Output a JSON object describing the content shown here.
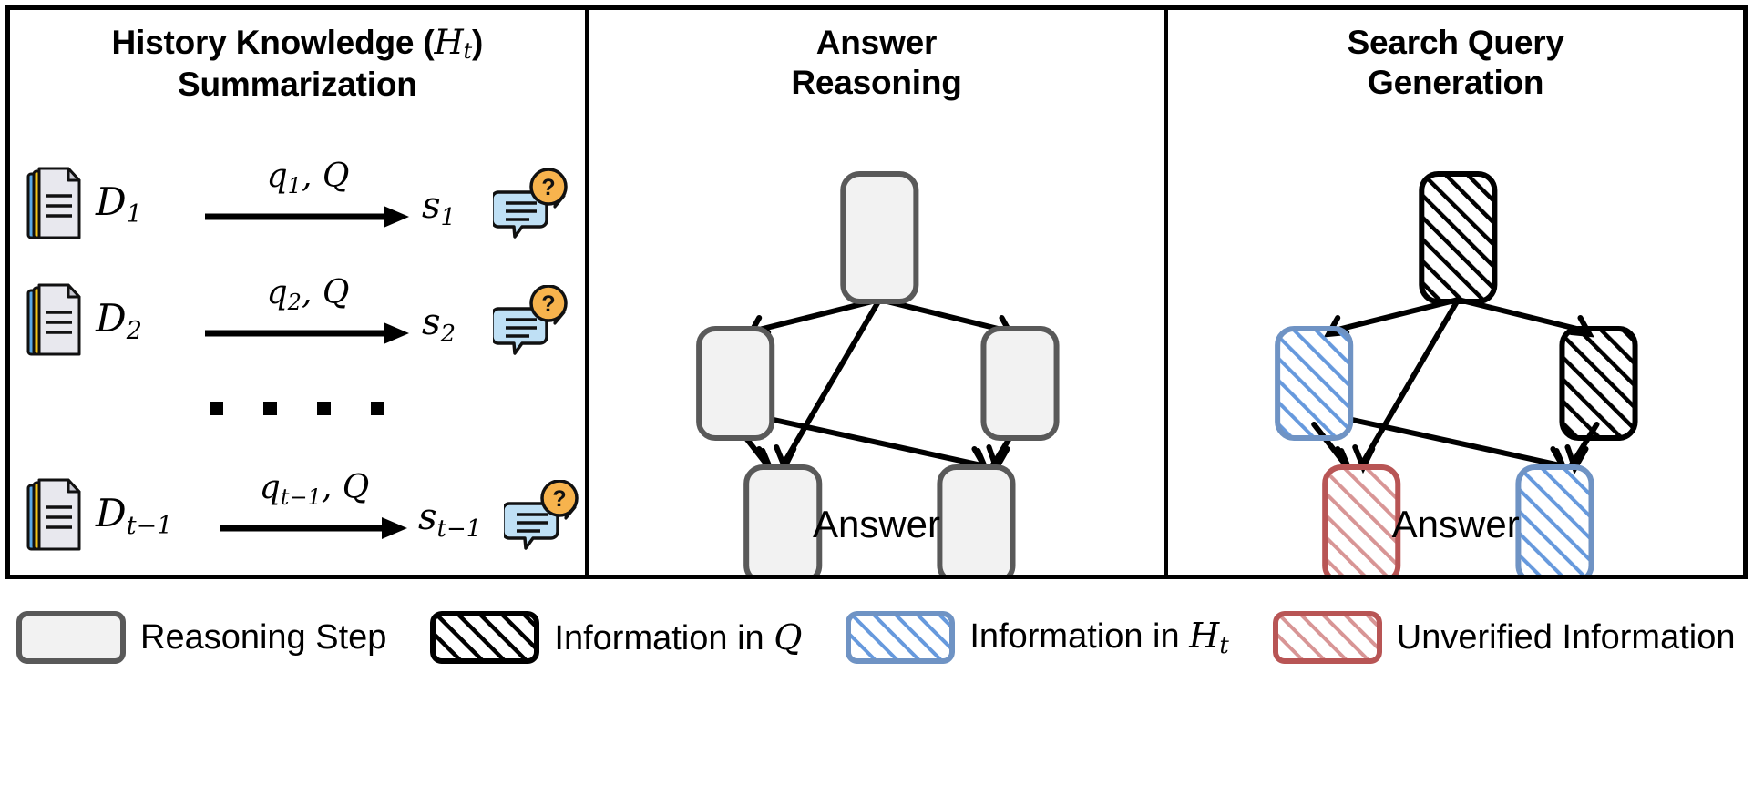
{
  "figure": {
    "panels": [
      {
        "id": "history-knowledge-summarization",
        "title_line1_pre": "History Knowledge (",
        "title_line1_cal": "H",
        "title_line1_sub": "t",
        "title_line1_post": ")",
        "title_line2": "Summarization",
        "rows": [
          {
            "doc": "D",
            "doc_sub": "1",
            "query": "q",
            "query_sub": "1",
            "query_rest": ", ",
            "query_cal": "Q",
            "summary": "s",
            "summary_sub": "1"
          },
          {
            "doc": "D",
            "doc_sub": "2",
            "query": "q",
            "query_sub": "2",
            "query_rest": ", ",
            "query_cal": "Q",
            "summary": "s",
            "summary_sub": "2"
          },
          {
            "doc": "D",
            "doc_sub": "t−1",
            "query": "q",
            "query_sub": "t−1",
            "query_rest": ", ",
            "query_cal": "Q",
            "summary": "s",
            "summary_sub": "t−1"
          }
        ],
        "ellipsis_dots": 4
      },
      {
        "id": "answer-reasoning",
        "title_line1": "Answer",
        "title_line2": "Reasoning",
        "answer_label": "Answer",
        "nodes": [
          {
            "name": "root",
            "style": "plain"
          },
          {
            "name": "level2-left",
            "style": "plain"
          },
          {
            "name": "level2-right",
            "style": "plain"
          },
          {
            "name": "level3-left",
            "style": "plain"
          },
          {
            "name": "level3-right",
            "style": "plain"
          }
        ]
      },
      {
        "id": "search-query-generation",
        "title_line1": "Search Query",
        "title_line2": "Generation",
        "answer_label": "Answer",
        "nodes": [
          {
            "name": "root",
            "style": "hatch-black"
          },
          {
            "name": "level2-left",
            "style": "hatch-blue"
          },
          {
            "name": "level2-right",
            "style": "hatch-black"
          },
          {
            "name": "level3-left",
            "style": "hatch-red"
          },
          {
            "name": "level3-right",
            "style": "hatch-blue"
          }
        ]
      }
    ],
    "edges": [
      "root->level2-left",
      "root->level2-right",
      "root->level3-left",
      "level2-left->level3-left",
      "level2-left->level3-right",
      "level2-right->level3-right",
      "level3-left->answer",
      "level3-right->answer"
    ],
    "legend": [
      {
        "swatch": "plain",
        "label": "Reasoning Step"
      },
      {
        "swatch": "hatch-black",
        "label_pre": "Information in ",
        "label_cal": "Q",
        "label_sub": ""
      },
      {
        "swatch": "hatch-blue",
        "label_pre": "Information in ",
        "label_cal": "H",
        "label_sub": "t"
      },
      {
        "swatch": "hatch-red",
        "label_pre": "Unverified Information",
        "label_cal": "",
        "label_sub": ""
      }
    ],
    "colors": {
      "node_fill": "#f2f2f2",
      "node_stroke": "#595959",
      "hatch_black": "#000000",
      "hatch_blue": "#6699dd",
      "hatch_blue_border": "#6f93c4",
      "hatch_red": "#d28f8f",
      "hatch_red_border": "#b85555",
      "doc_icon_paper": "#e8e8ee",
      "doc_icon_yellow": "#f5c518",
      "doc_icon_blue": "#5aa9e6",
      "chat_icon_fill": "#bfe0f5",
      "badge_orange": "#f7b34d",
      "panel_border": "#000000"
    }
  }
}
